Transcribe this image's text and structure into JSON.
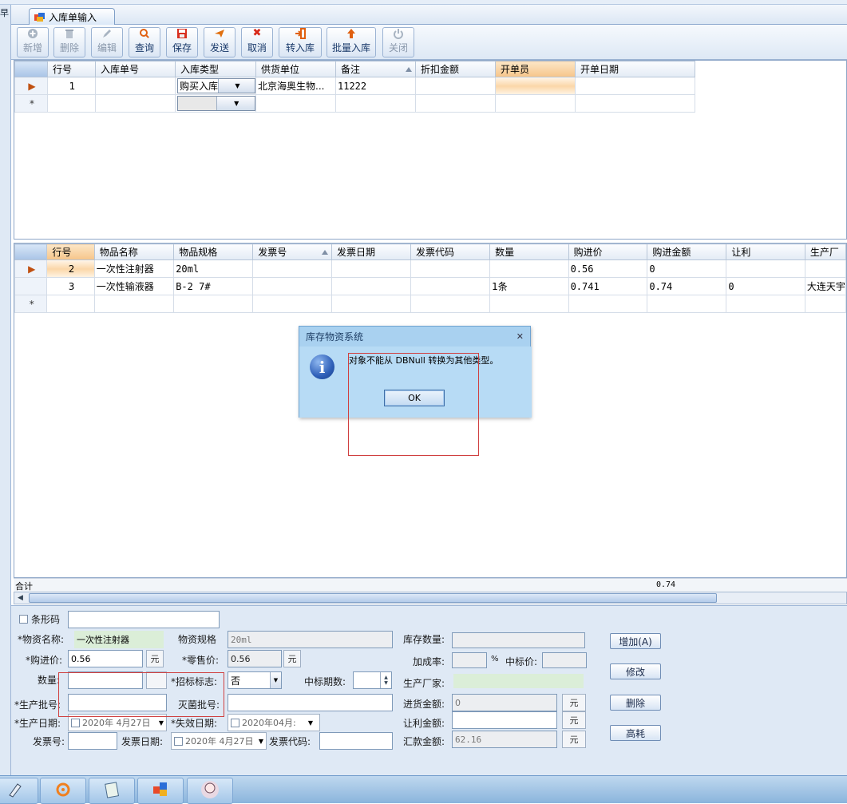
{
  "left_label": "早",
  "tab": {
    "title": "入库单输入"
  },
  "toolbar": [
    {
      "label": "新增",
      "icon": "add-icon",
      "enabled": false
    },
    {
      "label": "删除",
      "icon": "trash-icon",
      "enabled": false
    },
    {
      "label": "编辑",
      "icon": "edit-icon",
      "enabled": false
    },
    {
      "label": "查询",
      "icon": "search-icon",
      "enabled": true
    },
    {
      "label": "保存",
      "icon": "save-icon",
      "enabled": true
    },
    {
      "label": "发送",
      "icon": "send-icon",
      "enabled": true
    },
    {
      "label": "取消",
      "icon": "cancel-icon",
      "enabled": true
    },
    {
      "label": "转入库",
      "icon": "import-icon",
      "enabled": true
    },
    {
      "label": "批量入库",
      "icon": "batch-import-icon",
      "enabled": true
    },
    {
      "label": "关闭",
      "icon": "power-icon",
      "enabled": false
    }
  ],
  "master": {
    "columns": [
      "行号",
      "入库单号",
      "入库类型",
      "供货单位",
      "备注",
      "折扣金额",
      "开单员",
      "开单日期"
    ],
    "rows": [
      {
        "line": "1",
        "number": "",
        "type": "购买入库",
        "supplier": "北京海奥生物...",
        "remark": "11222",
        "discount": "",
        "clerk": "",
        "date": ""
      }
    ],
    "new_row_marker": "*"
  },
  "detail": {
    "columns": [
      "行号",
      "物品名称",
      "物品规格",
      "发票号",
      "发票日期",
      "发票代码",
      "数量",
      "购进价",
      "购进金额",
      "让利",
      "生产厂"
    ],
    "rows": [
      {
        "line": "2",
        "name": "一次性注射器",
        "spec": "20ml",
        "invoice": "",
        "invoice_date": "",
        "invoice_code": "",
        "qty": "",
        "price": "0.56",
        "amount": "0",
        "rebate": "",
        "maker": ""
      },
      {
        "line": "3",
        "name": "一次性输液器",
        "spec": "B-2 7#",
        "invoice": "",
        "invoice_date": "",
        "invoice_code": "",
        "qty": "1条",
        "price": "0.741",
        "amount": "0.74",
        "rebate": "0",
        "maker": "大连天宇"
      }
    ],
    "new_row_marker": "*"
  },
  "summary": {
    "label": "合计",
    "amount_total": "0.74"
  },
  "form": {
    "barcode_label": "条形码",
    "barcode_value": "",
    "name_label": "*物资名称:",
    "name_value": "一次性注射器",
    "spec_label": "物资规格",
    "spec_value": "20ml",
    "stock_label": "库存数量:",
    "stock_value": "",
    "price_label": "*购进价:",
    "price_value": "0.56",
    "yuan": "元",
    "retail_label": "*零售价:",
    "retail_value": "0.56",
    "markup_label": "加成率:",
    "markup_value": "",
    "percent": "%",
    "bid_price_label": "中标价:",
    "bid_price_value": "",
    "qty_label": "数量:",
    "qty_value": "",
    "bid_flag_label": "*招标标志:",
    "bid_flag_value": "否",
    "bid_period_label": "中标期数:",
    "bid_period_value": "",
    "maker_label": "生产厂家:",
    "maker_value": "",
    "batch_label": "*生产批号:",
    "batch_value": "",
    "sterile_label": "灭菌批号:",
    "sterile_value": "",
    "purchase_amount_label": "进货金额:",
    "purchase_amount_value": "0",
    "prod_date_label": "*生产日期:",
    "prod_date_value": "2020年  4月27日",
    "expire_label": "*失效日期:",
    "expire_value": "2020年04月:",
    "rebate_label": "让利金额:",
    "rebate_value": "",
    "invoice_no_label": "发票号:",
    "invoice_no_value": "",
    "invoice_date_label": "发票日期:",
    "invoice_date_value": "2020年  4月27日",
    "invoice_code_label": "发票代码:",
    "invoice_code_value": "",
    "total_label": "汇款金额:",
    "total_value": "62.16",
    "btn_add": "增加(A)",
    "btn_modify": "修改",
    "btn_delete": "删除",
    "btn_highuse": "高耗"
  },
  "dialog": {
    "title": "库存物资系统",
    "message": "对象不能从 DBNull 转换为其他类型。",
    "ok": "OK"
  },
  "taskbar": [
    "pen-tool-icon",
    "gear-app-icon",
    "notepad-icon",
    "blocks-icon",
    "avatar-icon"
  ]
}
